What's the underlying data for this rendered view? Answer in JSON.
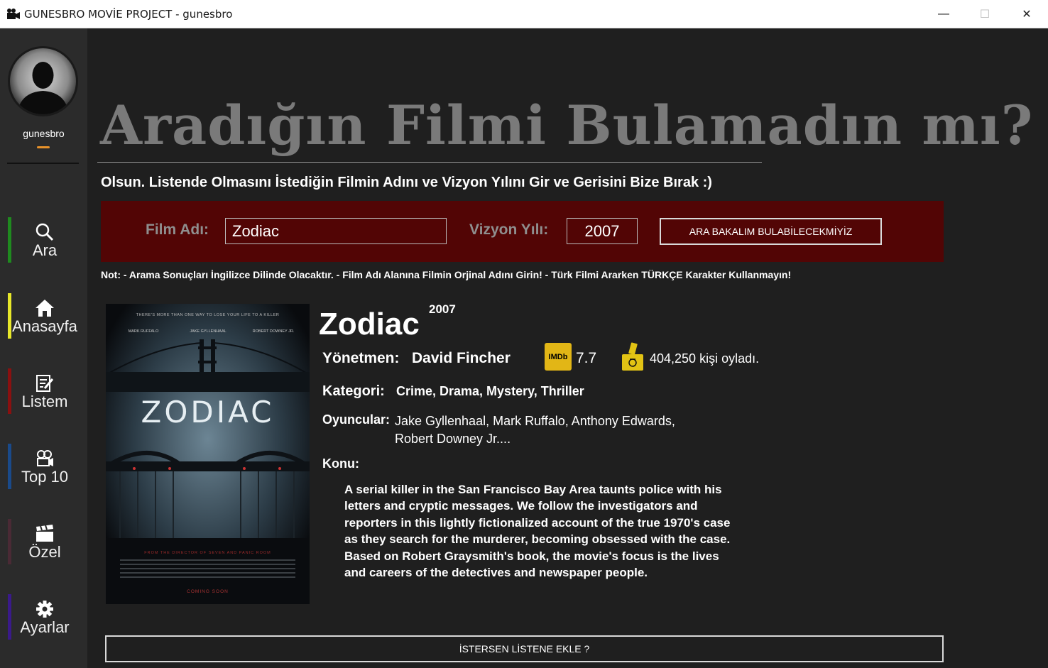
{
  "window": {
    "title": "GUNESBRO MOVİE PROJECT - gunesbro",
    "min_glyph": "—",
    "max_glyph": "☐",
    "close_glyph": "✕"
  },
  "sidebar": {
    "username": "gunesbro",
    "items": [
      {
        "label": "Ara",
        "icon": "search-icon",
        "color": "#1f8a1f"
      },
      {
        "label": "Anasayfa",
        "icon": "home-icon",
        "color": "#e8e82a"
      },
      {
        "label": "Listem",
        "icon": "list-edit-icon",
        "color": "#8a1010"
      },
      {
        "label": "Top 10",
        "icon": "projector-icon",
        "color": "#1a4a8a"
      },
      {
        "label": "Özel",
        "icon": "clapperboard-icon",
        "color": "#4a2a35"
      },
      {
        "label": "Ayarlar",
        "icon": "gear-icon",
        "color": "#3a1a8a"
      }
    ]
  },
  "main": {
    "headline": "Aradığın Filmi Bulamadın mı?",
    "subtitle": "Olsun. Listende Olmasını İstediğin Filmin Adını ve Vizyon Yılını Gir ve Gerisini Bize Bırak :)",
    "search": {
      "film_label": "Film Adı:",
      "film_value": "Zodiac",
      "year_label": "Vizyon Yılı:",
      "year_value": "2007",
      "button_label": "ARA BAKALIM BULABİLECEKMİYİZ"
    },
    "note": "Not: - Arama Sonuçları İngilizce Dilinde Olacaktır. - Film Adı Alanına Filmin Orjinal Adını Girin! - Türk Filmi Ararken TÜRKÇE Karakter Kullanmayın!",
    "movie": {
      "title": "Zodiac",
      "year": "2007",
      "poster": {
        "tagline": "THERE'S MORE THAN ONE WAY TO LOSE YOUR LIFE TO A KILLER",
        "actors": [
          "MARK RUFFALO",
          "JAKE GYLLENHAAL",
          "ROBERT DOWNEY JR."
        ],
        "title": "ZODIAC",
        "bottom_line": "FROM THE DIRECTOR OF SEVEN AND PANIC ROOM",
        "coming": "COMING SOON"
      },
      "director_label": "Yönetmen:",
      "director": "David Fincher",
      "imdb_badge": "IMDb",
      "imdb_rating": "7.7",
      "votes": "404,250 kişi oyladı.",
      "category_label": "Kategori:",
      "categories": "Crime, Drama, Mystery, Thriller",
      "cast_label": "Oyuncular:",
      "cast": "Jake Gyllenhaal, Mark Ruffalo, Anthony Edwards, Robert Downey Jr....",
      "plot_label": "Konu:",
      "plot": "A serial killer in the San Francisco Bay Area taunts police with his letters and cryptic messages. We follow the investigators and reporters in this lightly fictionalized account of the true 1970's case as they search for the murderer, becoming obsessed with the case. Based on Robert Graysmith's book, the movie's focus is the lives and careers of the detectives and newspaper people."
    },
    "add_button_label": "İSTERSEN LİSTENE EKLE ?"
  },
  "colors": {
    "accent_underline": "#e8922a",
    "search_panel": "#520505",
    "imdb_yellow": "#e2b616"
  }
}
